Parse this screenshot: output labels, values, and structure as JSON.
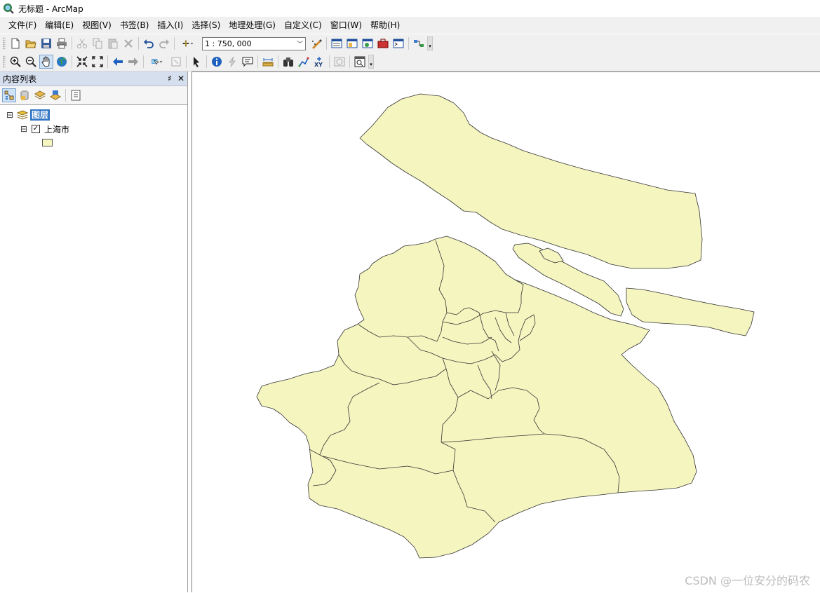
{
  "window": {
    "title": "无标题 - ArcMap"
  },
  "menu": [
    "文件(F)",
    "编辑(E)",
    "视图(V)",
    "书签(B)",
    "插入(I)",
    "选择(S)",
    "地理处理(G)",
    "自定义(C)",
    "窗口(W)",
    "帮助(H)"
  ],
  "toolbar": {
    "scale": "1 : 750, 000"
  },
  "toc": {
    "title": "内容列表",
    "pin_glyph": "♯",
    "close_glyph": "✕",
    "root_label": "图层",
    "layer_label": "上海市",
    "layer_checked": true,
    "symbol_color": "#f5f5c0",
    "expander_glyph": "⊟",
    "check_glyph": "✓"
  },
  "map": {
    "fill_color": "#f5f5c0",
    "stroke_color": "#333333"
  },
  "watermark": "CSDN @一位安分的码农",
  "icons": [
    "arcmap-app-icon",
    "new-document-icon",
    "open-icon",
    "save-icon",
    "print-icon",
    "cut-icon",
    "copy-icon",
    "paste-icon",
    "delete-icon",
    "undo-icon",
    "redo-icon",
    "add-data-icon",
    "editor-icon",
    "table-of-contents-icon",
    "catalog-icon",
    "search-window-icon",
    "arctoolbox-icon",
    "python-icon",
    "model-builder-icon",
    "zoom-in-icon",
    "zoom-out-icon",
    "pan-icon",
    "full-extent-icon",
    "fixed-zoom-in-icon",
    "fixed-zoom-out-icon",
    "back-extent-icon",
    "forward-extent-icon",
    "select-features-icon",
    "clear-selection-icon",
    "select-elements-icon",
    "identify-icon",
    "hyperlink-icon",
    "html-popup-icon",
    "measure-icon",
    "find-icon",
    "find-route-icon",
    "go-to-xy-icon",
    "time-slider-icon",
    "create-viewer-icon"
  ]
}
